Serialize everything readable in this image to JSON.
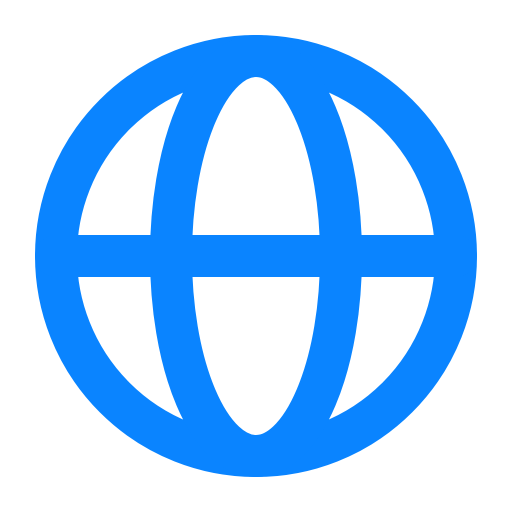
{
  "icon": {
    "name": "globe-icon",
    "color": "#0A84FF",
    "background": "#FFFFFF"
  }
}
